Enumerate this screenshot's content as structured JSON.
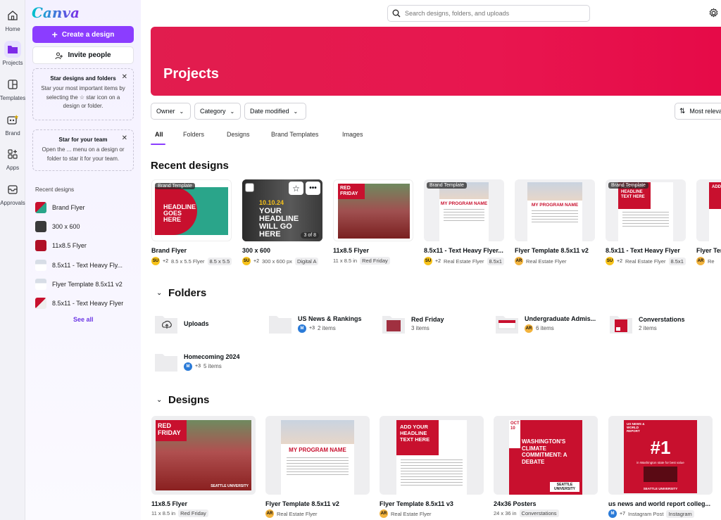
{
  "rail": [
    {
      "label": "Home",
      "icon": "home-icon"
    },
    {
      "label": "Projects",
      "icon": "folder-icon",
      "active": true
    },
    {
      "label": "Templates",
      "icon": "templates-icon"
    },
    {
      "label": "Brand",
      "icon": "brand-icon"
    },
    {
      "label": "Apps",
      "icon": "apps-icon"
    },
    {
      "label": "Approvals",
      "icon": "approvals-icon"
    }
  ],
  "sidebar": {
    "logo": "Canva",
    "create_label": "Create a design",
    "invite_label": "Invite people",
    "tip1": {
      "title": "Star designs and folders",
      "body": "Star your most important items by selecting the ☆ star icon on a design or folder."
    },
    "tip2": {
      "title": "Star for your team",
      "body": "Open the ... menu on a design or folder to star it for your team."
    },
    "recent_label": "Recent designs",
    "recent": [
      "Brand Flyer",
      "300 x 600",
      "11x8.5 Flyer",
      "8.5x11 - Text Heavy Fly...",
      "Flyer Template 8.5x11 v2",
      "8.5x11 - Text Heavy Flyer"
    ],
    "see_all": "See all"
  },
  "search": {
    "placeholder": "Search designs, folders, and uploads"
  },
  "banner": {
    "title": "Projects"
  },
  "filters": {
    "owner": "Owner",
    "category": "Category",
    "date": "Date modified",
    "sort": "Most relevant"
  },
  "tabs": [
    "All",
    "Folders",
    "Designs",
    "Brand Templates",
    "Images"
  ],
  "recent_section": {
    "title": "Recent designs",
    "cards": [
      {
        "title": "Brand Flyer",
        "avatar": "SU",
        "plus": "+2",
        "meta": "8.5 x 5.5 Flyer",
        "tag": "8.5 x 5.5",
        "badge": "Brand Template"
      },
      {
        "title": "300 x 600",
        "avatar": "SU",
        "plus": "+2",
        "meta": "300 x 600 px",
        "tag": "Digital A",
        "pages": "3 of 8",
        "headline": "YOUR HEADLINE WILL GO HERE",
        "date": "10.10.24"
      },
      {
        "title": "11x8.5 Flyer",
        "meta": "11 x 8.5 in",
        "tag": "Red Friday",
        "thumb_text": "RED FRIDAY"
      },
      {
        "title": "8.5x11 - Text Heavy Flyer...",
        "avatar": "SU",
        "plus": "+2",
        "meta": "Real Estate Flyer",
        "tag": "8.5x1",
        "badge": "Brand Template",
        "thumb_text": "MY PROGRAM NAME"
      },
      {
        "title": "Flyer Template 8.5x11 v2",
        "avatar": "AR",
        "meta": "Real Estate Flyer",
        "thumb_text": "MY PROGRAM NAME"
      },
      {
        "title": "8.5x11 - Text Heavy Flyer",
        "avatar": "SU",
        "plus": "+2",
        "meta": "Real Estate Flyer",
        "tag": "8.5x1",
        "badge": "Brand Template",
        "thumb_text": "ADD YOUR HEADLINE TEXT HERE"
      },
      {
        "title": "Flyer Tem",
        "avatar": "AR",
        "meta": "Re",
        "thumb_text": "ADD"
      }
    ]
  },
  "folders_section": {
    "title": "Folders",
    "items": [
      {
        "name": "Uploads"
      },
      {
        "name": "US News & Rankings",
        "avatar": "M",
        "plus": "+3",
        "count": "2 items"
      },
      {
        "name": "Red Friday",
        "count": "3 items"
      },
      {
        "name": "Undergraduate Admis...",
        "avatar": "AR",
        "count": "6 items"
      },
      {
        "name": "Converstations",
        "count": "2 items"
      },
      {
        "name": "Homecoming 2024",
        "avatar": "M",
        "plus": "+3",
        "count": "5 items"
      }
    ]
  },
  "designs_section": {
    "title": "Designs",
    "items": [
      {
        "title": "11x8.5 Flyer",
        "meta": "11 x 8.5 in",
        "tag": "Red Friday",
        "thumb_text": "RED FRIDAY",
        "footer": "SEATTLE UNIVERSITY"
      },
      {
        "title": "Flyer Template 8.5x11 v2",
        "avatar": "AR",
        "meta": "Real Estate Flyer",
        "thumb_text": "MY PROGRAM NAME"
      },
      {
        "title": "Flyer Template 8.5x11 v3",
        "avatar": "AR",
        "meta": "Real Estate Flyer",
        "thumb_text": "ADD YOUR HEADLINE TEXT HERE"
      },
      {
        "title": "24x36 Posters",
        "meta": "24 x 36 in",
        "tag": "Converstations",
        "thumb_text": "WASHINGTON'S CLIMATE COMMITMENT: A DEBATE",
        "date": "OCT 10",
        "footer": "SEATTLE UNIVERSITY"
      },
      {
        "title": "us news and world report colleg...",
        "avatar": "M",
        "plus": "+7",
        "meta": "Instagram Post",
        "tag": "Instagram",
        "thumb_text": "#1",
        "sub": "in Washington state for best value",
        "corner": "US NEWS & WORLD REPORT",
        "footer": "SEATTLE UNIVERSITY"
      }
    ]
  },
  "colors": {
    "accent": "#8b3dff",
    "banner": "#e8164f",
    "red": "#c8102e"
  }
}
